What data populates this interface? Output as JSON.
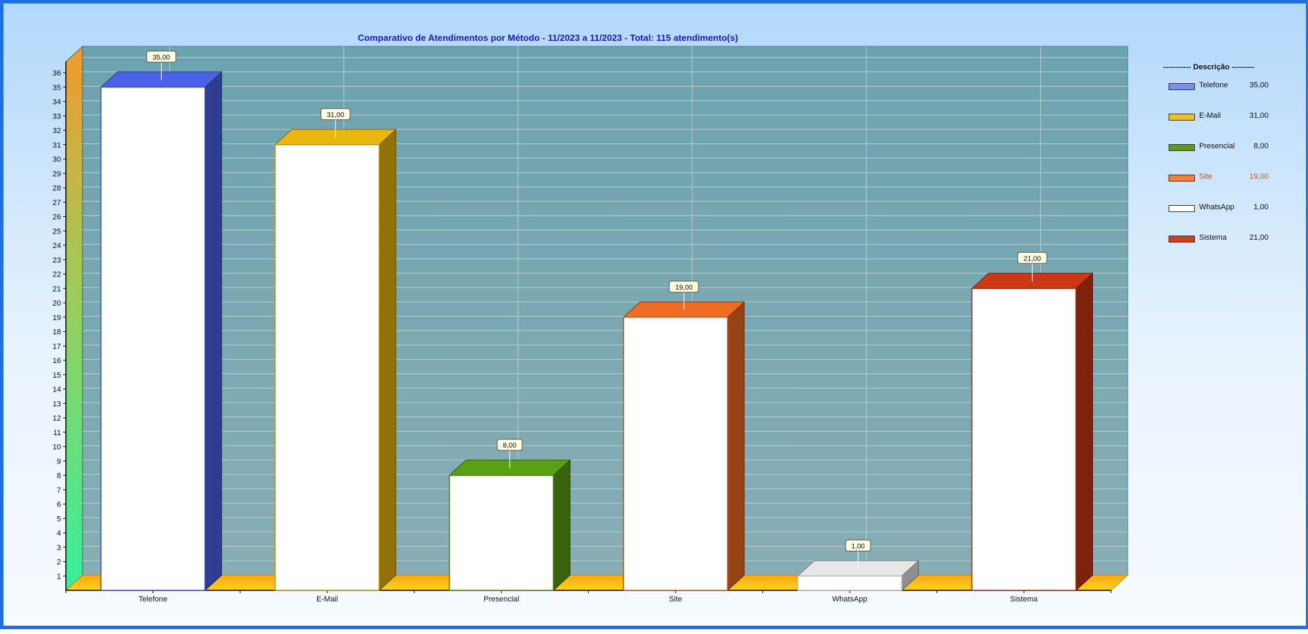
{
  "chart_data": {
    "type": "bar",
    "title": "Comparativo de Atendimentos por Método - 11/2023 a 11/2023 - Total: 115 atendimento(s)",
    "categories": [
      "Telefone",
      "E-Mail",
      "Presencial",
      "Site",
      "WhatsApp",
      "Sistema"
    ],
    "values": [
      35,
      31,
      8,
      19,
      1,
      21
    ],
    "value_labels": [
      "35,00",
      "31,00",
      "8,00",
      "19,00",
      "1,00",
      "21,00"
    ],
    "colors": [
      "#4a63e6",
      "#e8b80f",
      "#5aa014",
      "#f06c22",
      "#e6e6e6",
      "#cc3714"
    ],
    "ylim": [
      0,
      36
    ],
    "yticks": [
      "1",
      "2",
      "3",
      "4",
      "5",
      "6",
      "7",
      "8",
      "9",
      "10",
      "11",
      "12",
      "13",
      "14",
      "15",
      "16",
      "17",
      "18",
      "19",
      "20",
      "21",
      "22",
      "23",
      "24",
      "25",
      "26",
      "27",
      "28",
      "29",
      "30",
      "31",
      "32",
      "33",
      "34",
      "35",
      "36"
    ],
    "grid": true,
    "legend_position": "right",
    "legend": {
      "title": "----------- Descrição ---------",
      "items": [
        {
          "name": "Telefone",
          "value": "35,00",
          "color": "#7b8fee",
          "text_color": "#111111"
        },
        {
          "name": "E-Mail",
          "value": "31,00",
          "color": "#f2c313",
          "text_color": "#111111"
        },
        {
          "name": "Presencial",
          "value": "8,00",
          "color": "#5a9e18",
          "text_color": "#111111"
        },
        {
          "name": "Site",
          "value": "19,00",
          "color": "#f47f35",
          "text_color": "#d9461e"
        },
        {
          "name": "WhatsApp",
          "value": "1,00",
          "color": "#ffffff",
          "text_color": "#111111"
        },
        {
          "name": "Sistema",
          "value": "21,00",
          "color": "#d0401c",
          "text_color": "#111111"
        }
      ]
    }
  }
}
